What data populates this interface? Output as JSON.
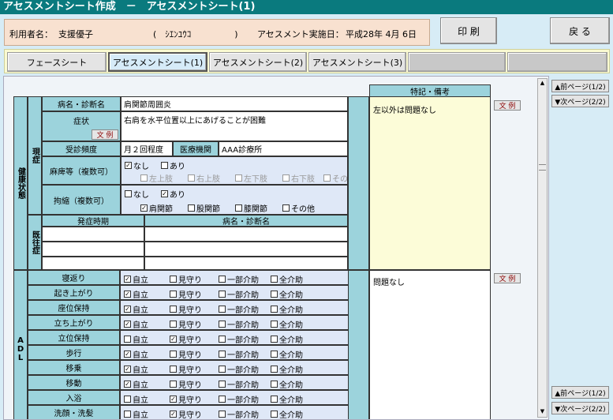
{
  "window": {
    "title": "アセスメントシート作成　－　アセスメントシート(1)"
  },
  "header": {
    "user_label": "利用者名：",
    "user_name": "支援優子",
    "user_kana": "(　ｼｴﾝﾕｳｺ　　　　　)",
    "date_label": "アセスメント実施日：",
    "date_value": "平成28年 4月 6日"
  },
  "buttons": {
    "print": "印 刷",
    "back": "戻 る"
  },
  "tabs": [
    "フェースシート",
    "アセスメントシート(1)",
    "アセスメントシート(2)",
    "アセスメントシート(3)"
  ],
  "sections": {
    "health": "健康状態",
    "current": "現症",
    "past": "既往症",
    "adl": "ADL"
  },
  "health": {
    "diagnosis_label": "病名・診断名",
    "diagnosis_value": "肩関節周囲炎",
    "symptom_label": "症状",
    "symptom_value": "右肩を水平位置以上にあげることが困難",
    "example_label": "文 例",
    "visit_label": "受診頻度",
    "visit_value": "月２回程度",
    "institution_label": "医療機関",
    "institution_value": "AAA診療所",
    "paralysis_label": "麻痺等（複数可）",
    "paralysis_options": [
      "なし",
      "あり"
    ],
    "paralysis_sub": [
      "左上肢",
      "右上肢",
      "左下肢",
      "右下肢",
      "その他"
    ],
    "contracture_label": "拘縮（複数可）",
    "contracture_options": [
      "なし",
      "あり"
    ],
    "contracture_sub": [
      "肩関節",
      "股関節",
      "膝関節",
      "その他"
    ]
  },
  "past": {
    "onset_header": "発症時期",
    "diagnosis_header": "病名・診断名"
  },
  "notes": {
    "header": "特記・備考",
    "health_note": "左以外は問題なし",
    "adl_note": "問題なし"
  },
  "adl": {
    "options": [
      "自立",
      "見守り",
      "一部介助",
      "全介助"
    ],
    "rows": [
      {
        "label": "寝返り",
        "sel": 0
      },
      {
        "label": "起き上がり",
        "sel": 0
      },
      {
        "label": "座位保持",
        "sel": 0
      },
      {
        "label": "立ち上がり",
        "sel": 0
      },
      {
        "label": "立位保持",
        "sel": 1
      },
      {
        "label": "歩行",
        "sel": 0
      },
      {
        "label": "移乗",
        "sel": 0
      },
      {
        "label": "移動",
        "sel": 0
      },
      {
        "label": "入浴",
        "sel": 1
      },
      {
        "label": "洗顔・洗髪",
        "sel": 1
      }
    ]
  },
  "nav": {
    "prev_page": "▲前ページ(1/2)",
    "next_page": "▼次ページ(2/2)"
  },
  "check_mark": "✓"
}
